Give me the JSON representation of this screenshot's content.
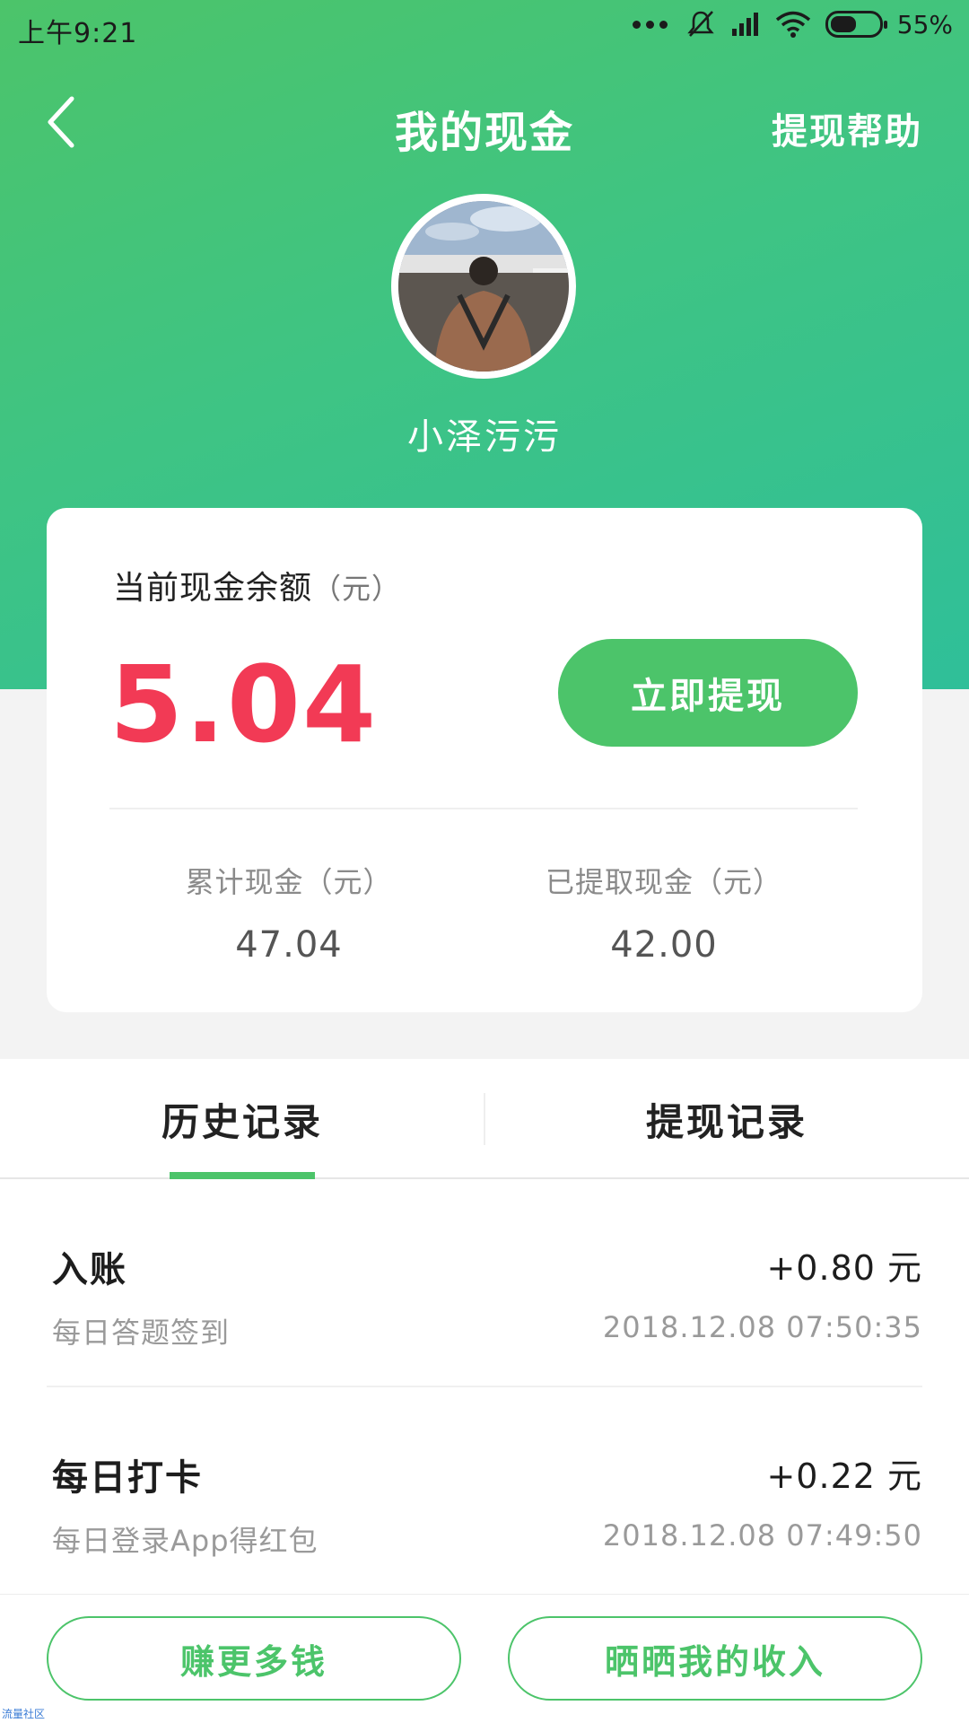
{
  "status_bar": {
    "time": "上午9:21",
    "battery": "55%",
    "battery_level": 0.55
  },
  "nav": {
    "title": "我的现金",
    "help": "提现帮助"
  },
  "user": {
    "name": "小泽污污"
  },
  "balance": {
    "label": "当前现金余额",
    "unit": "（元）",
    "value": "5.04",
    "withdraw_button": "立即提现"
  },
  "stats": {
    "total_label": "累计现金（元）",
    "total_value": "47.04",
    "withdrawn_label": "已提取现金（元）",
    "withdrawn_value": "42.00"
  },
  "tabs": [
    {
      "label": "历史记录",
      "active": true
    },
    {
      "label": "提现记录",
      "active": false
    }
  ],
  "records": [
    {
      "title": "入账",
      "amount": "+0.80 元",
      "desc": "每日答题签到",
      "time": "2018.12.08 07:50:35"
    },
    {
      "title": "每日打卡",
      "amount": "+0.22 元",
      "desc": "每日登录App得红包",
      "time": "2018.12.08 07:49:50"
    }
  ],
  "bottom": {
    "earn_more": "赚更多钱",
    "share_income": "晒晒我的收入"
  },
  "watermark": "流量社区",
  "colors": {
    "brand_green": "#4cc46a",
    "balance_red": "#f23a55"
  }
}
